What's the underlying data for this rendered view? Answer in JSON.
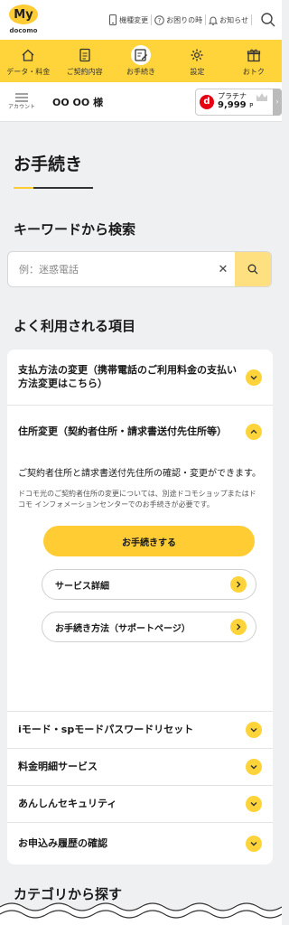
{
  "header": {
    "logo_text": "My",
    "logo_sub": "docomo",
    "links": [
      {
        "label": "機種変更",
        "icon": "phone-icon"
      },
      {
        "label": "お困りの時",
        "icon": "help-icon"
      },
      {
        "label": "お知らせ",
        "icon": "bell-icon"
      }
    ],
    "search_icon": "search-icon"
  },
  "gnav": [
    {
      "label": "データ・料金",
      "icon": "home-icon"
    },
    {
      "label": "ご契約内容",
      "icon": "document-icon"
    },
    {
      "label": "お手続き",
      "icon": "edit-icon",
      "active": true
    },
    {
      "label": "設定",
      "icon": "gear-icon"
    },
    {
      "label": "おトク",
      "icon": "gift-icon"
    }
  ],
  "account": {
    "menu_label": "アカウント",
    "user_name": "OO OO 様",
    "rank": "プラチナ",
    "points": "9,999",
    "points_unit": "P"
  },
  "page": {
    "title": "お手続き",
    "keyword_heading": "キーワードから検索",
    "search_placeholder": "例：迷惑電話",
    "frequent_heading": "よく利用される項目",
    "category_heading": "カテゴリから探す"
  },
  "items": [
    {
      "label": "支払方法の変更（携帯電話のご利用料金の支払い方法変更はこちら）"
    },
    {
      "label": "住所変更（契約者住所・請求書送付先住所等）",
      "expanded": true
    },
    {
      "label": "iモード・spモードパスワードリセット"
    },
    {
      "label": "料金明細サービス"
    },
    {
      "label": "あんしんセキュリティ"
    },
    {
      "label": "お申込み履歴の確認"
    }
  ],
  "expanded": {
    "desc": "ご契約者住所と請求書送付先住所の確認・変更ができます。",
    "note": "ドコモ光のご契約者住所の変更については、別途ドコモショップまたはドコモ インフォメーションセンターでのお手続きが必要です。",
    "primary_button": "お手続きする",
    "service_detail": "サービス詳細",
    "howto": "お手続き方法（サポートページ）"
  },
  "colors": {
    "accent": "#ffd43b",
    "brand_red": "#e60012"
  }
}
